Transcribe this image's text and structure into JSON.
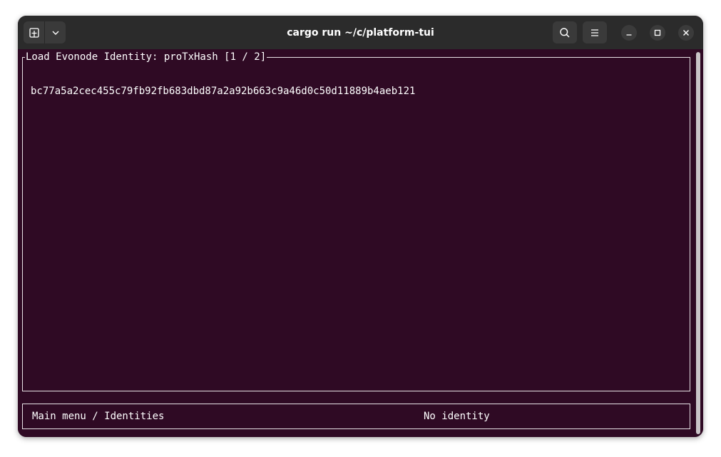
{
  "window": {
    "title": "cargo run ~/c/platform-tui",
    "titlebar_color": "#2b2b2b",
    "background_color": "#2f0a24"
  },
  "toolbar": {
    "new_tab_icon": "new-tab-icon",
    "dropdown_icon": "chevron-down-icon",
    "search_icon": "search-icon",
    "menu_icon": "hamburger-menu-icon",
    "minimize_icon": "minimize-icon",
    "maximize_icon": "maximize-icon",
    "close_icon": "close-icon"
  },
  "panel": {
    "title": "Load Evonode Identity: proTxHash [1 / 2]",
    "input_value": "bc77a5a2cec455c79fb92fb683dbd87a2a92b663c9a46d0c50d11889b4aeb121"
  },
  "status_bar": {
    "breadcrumb": "Main menu / Identities",
    "identity_status": "No identity"
  }
}
